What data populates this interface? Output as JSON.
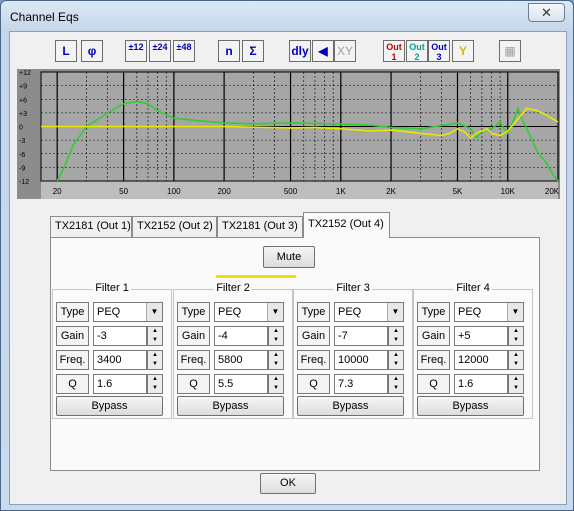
{
  "window": {
    "title": "Channel Eqs",
    "close_glyph": "✕"
  },
  "toolbar": [
    {
      "name": "linear-scale-button",
      "label": "L",
      "cls": "blue"
    },
    {
      "name": "phase-button",
      "label": "φ",
      "cls": "blue"
    },
    {
      "name": "slope-12-button",
      "label": "±12",
      "cls": "blue sm"
    },
    {
      "name": "slope-24-button",
      "label": "±24",
      "cls": "blue sm"
    },
    {
      "name": "slope-48-button",
      "label": "±48",
      "cls": "blue sm"
    },
    {
      "name": "n-button",
      "label": "n",
      "cls": "blue"
    },
    {
      "name": "sum-button",
      "label": "Σ",
      "cls": "blue"
    },
    {
      "name": "delay-button",
      "label": "dly",
      "cls": "blue"
    },
    {
      "name": "speaker-button",
      "label": "◀",
      "cls": "blue"
    },
    {
      "name": "xy-button",
      "label": "XY",
      "cls": "grey"
    },
    {
      "name": "out1-button",
      "label": "Out 1",
      "cls": "red sm"
    },
    {
      "name": "out2-button",
      "label": "Out 2",
      "cls": "cyan sm"
    },
    {
      "name": "out3-button",
      "label": "Out 3",
      "cls": "blue sm"
    },
    {
      "name": "out4-button",
      "label": "Y",
      "cls": "yel"
    },
    {
      "name": "grid-button",
      "label": "▦",
      "cls": "grey"
    }
  ],
  "chart_data": {
    "type": "line",
    "xscale": "log",
    "xlim": [
      16,
      20000
    ],
    "ylim": [
      -12,
      12
    ],
    "xticks": [
      "20",
      "50",
      "100",
      "200",
      "500",
      "1K",
      "2K",
      "5K",
      "10K",
      "20K"
    ],
    "xtick_values": [
      20,
      50,
      100,
      200,
      500,
      1000,
      2000,
      5000,
      10000,
      20000
    ],
    "yticks": [
      "+12",
      "+9",
      "+6",
      "+3",
      "0",
      "-3",
      "-6",
      "-9",
      "-12"
    ],
    "ytick_values": [
      12,
      9,
      6,
      3,
      0,
      -3,
      -6,
      -9,
      -12
    ],
    "grid": true,
    "series": [
      {
        "color": "#33cc33",
        "x": [
          20,
          22,
          25,
          30,
          40,
          50,
          60,
          70,
          80,
          100,
          150,
          200,
          300,
          500,
          700,
          1000,
          1500,
          2000,
          3000,
          4000,
          5000,
          6000,
          6500,
          7000,
          8000,
          9000,
          9500,
          10000,
          11000,
          11500,
          12000,
          13000,
          14000,
          15000,
          17000,
          19000,
          20000
        ],
        "y": [
          -12,
          -9,
          -4,
          0,
          3,
          5,
          5.5,
          5,
          3.5,
          1.8,
          1.2,
          0.8,
          0.6,
          0.8,
          0.7,
          0.5,
          0.3,
          -0.2,
          -0.5,
          0.2,
          0.8,
          -0.5,
          -2.5,
          -1,
          -0.5,
          1,
          -0.5,
          -1.5,
          2,
          4,
          2,
          -0.5,
          -3,
          -5.5,
          -8,
          -11,
          -12
        ]
      },
      {
        "color": "#e8e800",
        "x": [
          16,
          200,
          500,
          700,
          1000,
          1500,
          2000,
          3000,
          4000,
          4500,
          5000,
          5500,
          6000,
          6500,
          7000,
          7500,
          8000,
          9000,
          10000,
          11000,
          12000,
          13000,
          15000,
          17000,
          20000
        ],
        "y": [
          0,
          0,
          -0.3,
          -0.2,
          -0.5,
          -1,
          -0.8,
          -1.5,
          -2,
          -1.5,
          -0.5,
          -1.2,
          -2.5,
          -1.5,
          -1,
          -0.5,
          -1.5,
          -2,
          -1,
          0.8,
          2.5,
          4,
          3.5,
          2.5,
          1
        ]
      }
    ]
  },
  "tabs": [
    {
      "label": "TX2181 (Out 1)",
      "selected": false
    },
    {
      "label": "TX2152 (Out 2)",
      "selected": false
    },
    {
      "label": "TX2181 (Out 3)",
      "selected": false
    },
    {
      "label": "TX2152 (Out 4)",
      "selected": true
    }
  ],
  "mute_label": "Mute",
  "row_labels": {
    "type": "Type",
    "gain": "Gain",
    "freq": "Freq.",
    "q": "Q"
  },
  "filters": [
    {
      "title": "Filter 1",
      "type": "PEQ",
      "gain": "-3",
      "freq": "3400",
      "q": "1.6",
      "bypass": "Bypass"
    },
    {
      "title": "Filter 2",
      "type": "PEQ",
      "gain": "-4",
      "freq": "5800",
      "q": "5.5",
      "bypass": "Bypass"
    },
    {
      "title": "Filter 3",
      "type": "PEQ",
      "gain": "-7",
      "freq": "10000",
      "q": "7.3",
      "bypass": "Bypass"
    },
    {
      "title": "Filter 4",
      "type": "PEQ",
      "gain": "+5",
      "freq": "12000",
      "q": "1.6",
      "bypass": "Bypass"
    }
  ],
  "ok_label": "OK"
}
